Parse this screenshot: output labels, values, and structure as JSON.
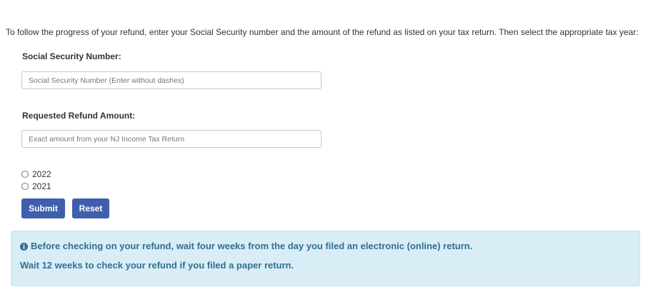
{
  "intro_text": "To follow the progress of your refund, enter your Social Security number and the amount of the refund as listed on your tax return. Then select the appropriate tax year:",
  "ssn": {
    "label": "Social Security Number:",
    "placeholder": "Social Security Number (Enter without dashes)",
    "value": ""
  },
  "refund": {
    "label": "Requested Refund Amount:",
    "placeholder": "Exact amount from your NJ Income Tax Return",
    "value": ""
  },
  "tax_years": [
    {
      "label": "2022",
      "selected": false
    },
    {
      "label": "2021",
      "selected": false
    }
  ],
  "buttons": {
    "submit_label": "Submit",
    "reset_label": "Reset"
  },
  "notice": {
    "icon": "info-circle-icon",
    "line1": "Before checking on your refund, wait four weeks from the day you filed an electronic (online) return.",
    "line2": "Wait 12 weeks to check your refund if you filed a paper return."
  },
  "colors": {
    "button_bg": "#3f5fad",
    "alert_bg": "#d9edf7",
    "alert_text": "#31708f"
  }
}
